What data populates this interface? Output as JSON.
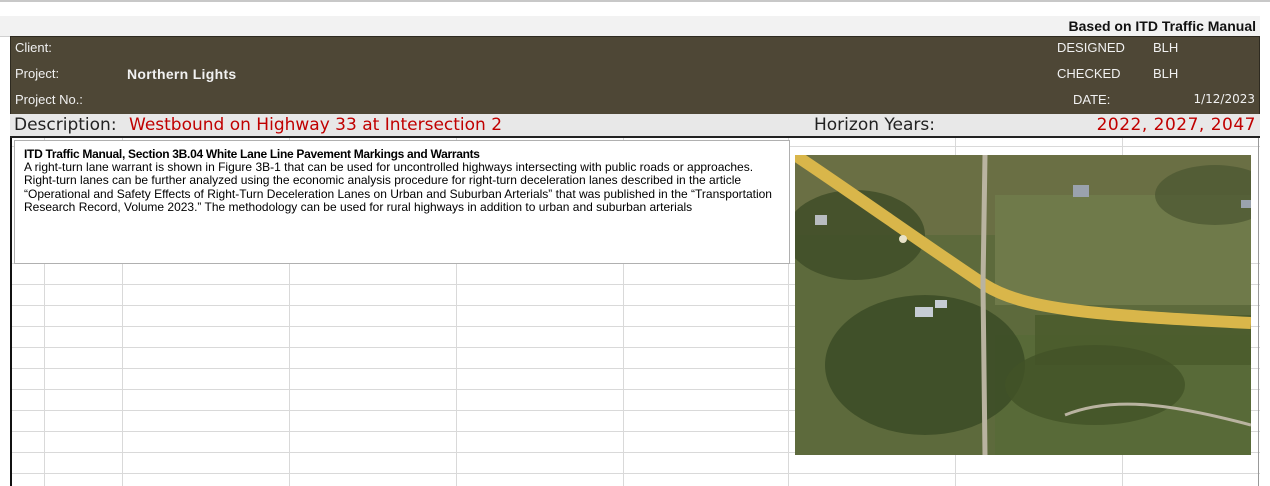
{
  "manual_label": "Based on ITD Traffic Manual",
  "header": {
    "client_label": "Client:",
    "client_value": "",
    "project_label": "Project:",
    "project_value": "Northern Lights",
    "project_no_label": "Project No.:",
    "project_no_value": "",
    "designed_label": "DESIGNED",
    "designed_value": "BLH",
    "checked_label": "CHECKED",
    "checked_value": "BLH",
    "date_label": "DATE:",
    "date_value": "1/12/2023"
  },
  "description": {
    "label": "Description:",
    "value": "Westbound on Highway 33 at Intersection 2",
    "horizon_label": "Horizon Years:",
    "horizon_value": "2022, 2027, 2047"
  },
  "note": {
    "title": "ITD Traffic Manual, Section 3B.04 White Lane Line Pavement Markings and Warrants",
    "body": "A right-turn lane warrant is shown in Figure 3B-1 that can be used for uncontrolled highways intersecting with public roads or approaches. Right-turn lanes can be further analyzed using the economic analysis procedure for right-turn deceleration lanes described in the article “Operational and Safety Effects of Right-Turn Deceleration Lanes on Urban and Suburban Arterials” that was published in the “Transportation Research Record, Volume 2023.” The methodology can be used for rural highways in addition to urban and suburban arterials"
  },
  "image": {
    "name": "aerial-photo-intersection"
  },
  "colors": {
    "header_bg": "#4e4736",
    "accent_red": "#c00000",
    "road": "#d9b64a"
  }
}
